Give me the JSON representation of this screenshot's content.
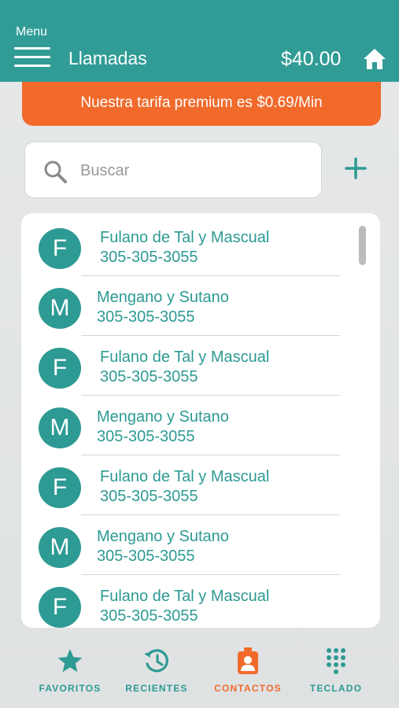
{
  "header": {
    "menu_label": "Menu",
    "title": "Llamadas",
    "balance": "$40.00"
  },
  "promo": {
    "text": "Nuestra tarifa premium es $0.69/Min"
  },
  "search": {
    "placeholder": "Buscar",
    "value": ""
  },
  "contacts": [
    {
      "initial": "F",
      "name": "Fulano de Tal y Mascual",
      "phone": "305-305-3055"
    },
    {
      "initial": "M",
      "name": "Mengano y Sutano",
      "phone": "305-305-3055"
    },
    {
      "initial": "F",
      "name": "Fulano de Tal y Mascual",
      "phone": "305-305-3055"
    },
    {
      "initial": "M",
      "name": "Mengano y Sutano",
      "phone": "305-305-3055"
    },
    {
      "initial": "F",
      "name": "Fulano de Tal y Mascual",
      "phone": "305-305-3055"
    },
    {
      "initial": "M",
      "name": "Mengano y Sutano",
      "phone": "305-305-3055"
    },
    {
      "initial": "F",
      "name": "Fulano de Tal y Mascual",
      "phone": "305-305-3055"
    }
  ],
  "tabs": [
    {
      "label": "FAVORITOS",
      "icon": "star-icon",
      "active": false
    },
    {
      "label": "RECIENTES",
      "icon": "history-icon",
      "active": false
    },
    {
      "label": "CONTACTOS",
      "icon": "contacts-icon",
      "active": true
    },
    {
      "label": "TECLADO",
      "icon": "dialpad-icon",
      "active": false
    }
  ],
  "colors": {
    "primary": "#319c96",
    "accent": "#f16a2c",
    "background": "#e3e5e6"
  }
}
